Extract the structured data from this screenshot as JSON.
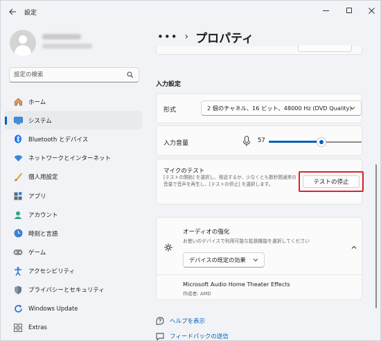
{
  "window": {
    "app_title": "設定"
  },
  "sidebar": {
    "search_placeholder": "設定の検索",
    "items": [
      {
        "label": "ホーム",
        "icon": "home-icon",
        "color": "#c17c4a"
      },
      {
        "label": "システム",
        "icon": "system-icon",
        "color": "#2b7bd3",
        "active": true
      },
      {
        "label": "Bluetooth とデバイス",
        "icon": "bluetooth-icon",
        "color": "#1a73e8"
      },
      {
        "label": "ネットワークとインターネット",
        "icon": "network-icon",
        "color": "#3a86d8"
      },
      {
        "label": "個人用設定",
        "icon": "brush-icon",
        "color": "#d9822b"
      },
      {
        "label": "アプリ",
        "icon": "apps-icon",
        "color": "#5b6b80"
      },
      {
        "label": "アカウント",
        "icon": "account-icon",
        "color": "#2aa58a"
      },
      {
        "label": "時刻と言語",
        "icon": "time-language-icon",
        "color": "#3f7fd0"
      },
      {
        "label": "ゲーム",
        "icon": "game-icon",
        "color": "#777777"
      },
      {
        "label": "アクセシビリティ",
        "icon": "accessibility-icon",
        "color": "#1f6fcf"
      },
      {
        "label": "プライバシーとセキュリティ",
        "icon": "shield-icon",
        "color": "#7a8796"
      },
      {
        "label": "Windows Update",
        "icon": "windows-update-icon",
        "color": "#1f6fcf"
      },
      {
        "label": "Extras",
        "icon": "extras-icon",
        "color": "#555555"
      }
    ]
  },
  "main": {
    "breadcrumb_dots": "•••",
    "breadcrumb_chevron": "›",
    "page_title": "プロパティ",
    "section_title": "入力設定",
    "format": {
      "label": "形式",
      "value": "2 個のチャネル、16 ビット、48000 Hz (DVD Quality)"
    },
    "volume": {
      "label": "入力音量",
      "value_text": "57",
      "level": 0.57
    },
    "mic_test": {
      "title": "マイクのテスト",
      "description": "[テストの開始] を選択し、発話するか、少なくとも数秒間通常の音量で音声を再生し、[テストの停止] を選択します。",
      "button_label": "テストの停止"
    },
    "enhancements": {
      "title": "オーディオの強化",
      "description": "お使いのデバイスで利用可能な拡張機能を選択してください",
      "select_value": "デバイスの既定の効果",
      "effect_name": "Microsoft Audio Home Theater Effects",
      "effect_author": "作成者: AMD"
    },
    "footer": {
      "help_label": "ヘルプを表示",
      "feedback_label": "フィードバックの送信"
    }
  },
  "colors": {
    "accent": "#005fb8",
    "highlight_border": "#e0202a"
  }
}
